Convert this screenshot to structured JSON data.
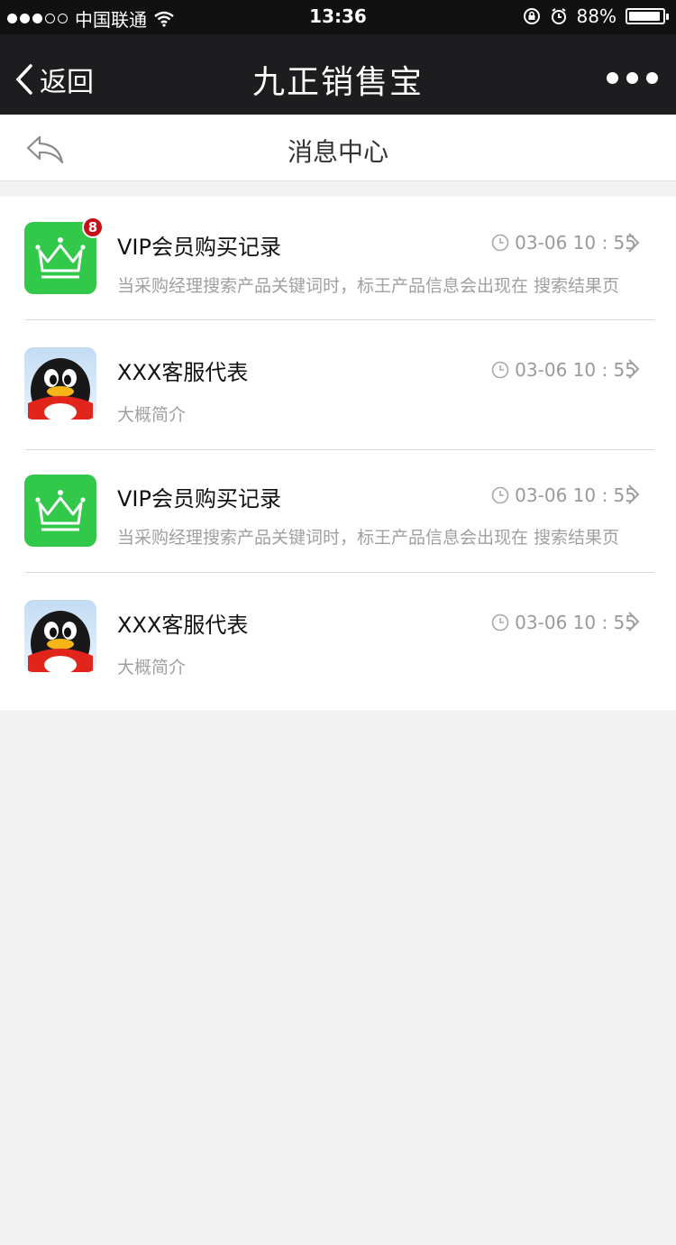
{
  "status_bar": {
    "carrier": "中国联通",
    "time": "13:36",
    "battery": "88%",
    "battery_level": 0.88,
    "signal_bars": 3
  },
  "nav": {
    "back_label": "返回",
    "title": "九正销售宝"
  },
  "sub_header": {
    "title": "消息中心"
  },
  "messages": [
    {
      "title": "VIP会员购买记录",
      "time": "03-06  10 : 55",
      "desc": "当采购经理搜索产品关键词时，标王产品信息会出现在 搜索结果页",
      "icon": "crown-icon",
      "badge": "8"
    },
    {
      "title": "XXX客服代表",
      "time": "03-06  10 : 55",
      "desc": "大概简介",
      "icon": "penguin-icon"
    },
    {
      "title": "VIP会员购买记录",
      "time": "03-06  10 : 55",
      "desc": "当采购经理搜索产品关键词时，标王产品信息会出现在 搜索结果页",
      "icon": "crown-icon"
    },
    {
      "title": "XXX客服代表",
      "time": "03-06  10 : 55",
      "desc": "大概简介",
      "icon": "penguin-icon"
    }
  ],
  "colors": {
    "nav_bg": "#1d1d1f",
    "crown_bg": "#32c84a",
    "badge": "#c8101a"
  }
}
